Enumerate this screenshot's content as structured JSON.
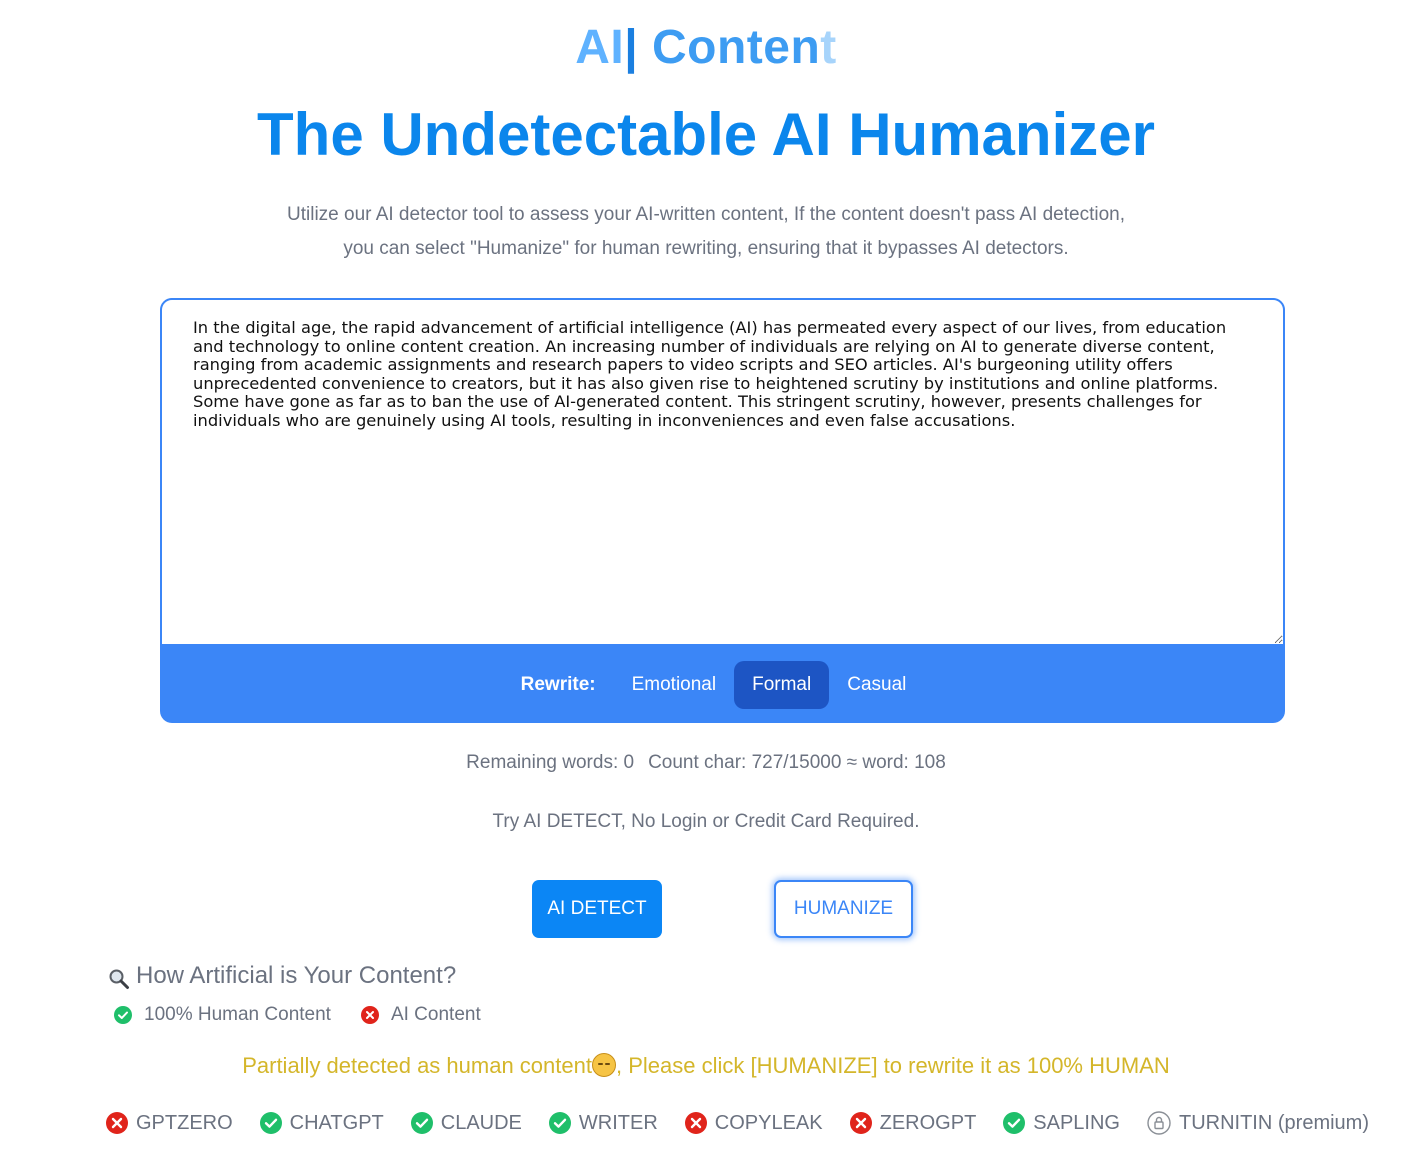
{
  "logo": {
    "ai": "AI",
    "cursor": "|",
    "content": "Conten",
    "fade": "t"
  },
  "headline": "The Undetectable AI Humanizer",
  "subtitle": "Utilize our AI detector tool to assess your AI-written content, If the content doesn't pass AI detection, you can select \"Humanize\" for human rewriting, ensuring that it bypasses AI detectors.",
  "editor": {
    "text": "In the digital age, the rapid advancement of artificial intelligence (AI) has permeated every aspect of our lives, from education and technology to online content creation. An increasing number of individuals are relying on AI to generate diverse content, ranging from academic assignments and research papers to video scripts and SEO articles. AI's burgeoning utility offers unprecedented convenience to creators, but it has also given rise to heightened scrutiny by institutions and online platforms. Some have gone as far as to ban the use of AI-generated content. This stringent scrutiny, however, presents challenges for individuals who are genuinely using AI tools, resulting in inconveniences and even false accusations."
  },
  "rewrite": {
    "label": "Rewrite:",
    "tones": [
      "Emotional",
      "Formal",
      "Casual"
    ],
    "active": "Formal"
  },
  "stats": {
    "remaining": "Remaining words: 0",
    "count": "Count char: 727/15000 ≈ word: 108"
  },
  "try_text": "Try AI DETECT, No Login or Credit Card Required.",
  "buttons": {
    "detect": "AI DETECT",
    "humanize": "HUMANIZE"
  },
  "result": {
    "heading": "How Artificial is Your Content?",
    "legend_human": "100% Human Content",
    "legend_ai": "AI Content",
    "message_before": "Partially detected as human content",
    "message_after": ", Please click [HUMANIZE] to rewrite it as 100% HUMAN"
  },
  "detectors": [
    {
      "name": "GPTZERO",
      "status": "ai"
    },
    {
      "name": "CHATGPT",
      "status": "human"
    },
    {
      "name": "CLAUDE",
      "status": "human"
    },
    {
      "name": "WRITER",
      "status": "human"
    },
    {
      "name": "COPYLEAK",
      "status": "ai"
    },
    {
      "name": "ZEROGPT",
      "status": "ai"
    },
    {
      "name": "SAPLING",
      "status": "human"
    },
    {
      "name": "TURNITIN",
      "status": "locked",
      "note": "(premium)"
    }
  ],
  "colors": {
    "accent": "#3b86f7",
    "human": "#1fbf6a",
    "ai": "#e0241b",
    "partial": "#d4b62a"
  }
}
